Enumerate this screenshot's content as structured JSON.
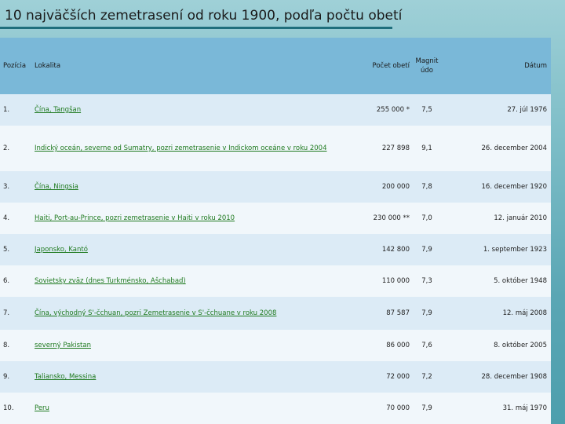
{
  "title": "10 najväčších zemetrasení od roku 1900, podľa počtu obetí",
  "table": {
    "headers": {
      "position": "Pozícia",
      "location": "Lokalita",
      "victims": "Počet obetí",
      "magnitude": "Magnit údo",
      "date": "Dátum"
    },
    "rows": [
      {
        "position": "1.",
        "location": "Čína, Tangšan",
        "victims": "255 000 *",
        "magnitude": "7,5",
        "date": "27. júl 1976"
      },
      {
        "position": "2.",
        "location": "Indický oceán, severne od Sumatry, pozri zemetrasenie v Indickom oceáne v roku 2004",
        "victims": "227 898",
        "magnitude": "9,1",
        "date": "26. december 2004"
      },
      {
        "position": "3.",
        "location": "Čína, Ningsia",
        "victims": "200 000",
        "magnitude": "7,8",
        "date": "16. december 1920"
      },
      {
        "position": "4.",
        "location": "Haiti, Port-au-Prince, pozri zemetrasenie v Haiti v roku 2010",
        "victims": "230 000 **",
        "magnitude": "7,0",
        "date": "12. január 2010"
      },
      {
        "position": "5.",
        "location": "Japonsko, Kantó",
        "victims": "142 800",
        "magnitude": "7,9",
        "date": "1. september 1923"
      },
      {
        "position": "6.",
        "location": "Sovietsky zväz (dnes Turkménsko, Ašchabad)",
        "victims": "110 000",
        "magnitude": "7,3",
        "date": "5. október 1948"
      },
      {
        "position": "7.",
        "location": "Čína, východný S'-čchuan, pozri Zemetrasenie v S'-čchuane v roku 2008",
        "victims": "87 587",
        "magnitude": "7,9",
        "date": "12. máj 2008"
      },
      {
        "position": "8.",
        "location": "severný Pakistan",
        "victims": "86 000",
        "magnitude": "7,6",
        "date": "8. október 2005"
      },
      {
        "position": "9.",
        "location": "Taliansko, Messina",
        "victims": "72 000",
        "magnitude": "7,2",
        "date": "28. december 1908"
      },
      {
        "position": "10.",
        "location": "Peru",
        "victims": "70 000",
        "magnitude": "7,9",
        "date": "31. máj 1970"
      }
    ]
  }
}
